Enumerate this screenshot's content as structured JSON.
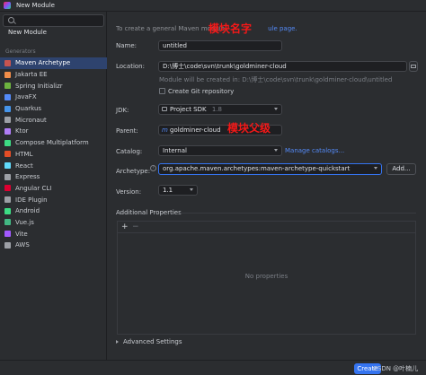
{
  "window": {
    "title": "New Module",
    "app_icon": "intellij-idea-icon"
  },
  "sidebar": {
    "search_placeholder": "",
    "top_item": "New Module",
    "generators_heading": "Generators",
    "items": [
      {
        "label": "Maven Archetype",
        "icon": "maven-icon",
        "color": "#c75450",
        "selected": true
      },
      {
        "label": "Jakarta EE",
        "icon": "jakarta-icon",
        "color": "#f08d49"
      },
      {
        "label": "Spring Initializr",
        "icon": "spring-icon",
        "color": "#6db33f"
      },
      {
        "label": "JavaFX",
        "icon": "javafx-icon",
        "color": "#548af7"
      },
      {
        "label": "Quarkus",
        "icon": "quarkus-icon",
        "color": "#4695eb"
      },
      {
        "label": "Micronaut",
        "icon": "micronaut-icon",
        "color": "#9da0a6"
      },
      {
        "label": "Ktor",
        "icon": "ktor-icon",
        "color": "#b07df6"
      },
      {
        "label": "Compose Multiplatform",
        "icon": "compose-icon",
        "color": "#3ddc84"
      },
      {
        "label": "HTML",
        "icon": "html-icon",
        "color": "#e44d26"
      },
      {
        "label": "React",
        "icon": "react-icon",
        "color": "#61dafb"
      },
      {
        "label": "Express",
        "icon": "express-icon",
        "color": "#9da0a6"
      },
      {
        "label": "Angular CLI",
        "icon": "angular-icon",
        "color": "#dd0031"
      },
      {
        "label": "IDE Plugin",
        "icon": "plugin-icon",
        "color": "#9da0a6"
      },
      {
        "label": "Android",
        "icon": "android-icon",
        "color": "#3ddc84"
      },
      {
        "label": "Vue.js",
        "icon": "vue-icon",
        "color": "#42b883"
      },
      {
        "label": "Vite",
        "icon": "vite-icon",
        "color": "#a259ff"
      },
      {
        "label": "AWS",
        "icon": "aws-icon",
        "color": "#9da0a6"
      }
    ]
  },
  "form": {
    "intro_prefix": "To create a general Maven module",
    "intro_link": "ule page.",
    "name_label": "Name:",
    "name_value": "untitled",
    "location_label": "Location:",
    "location_value": "D:\\博士\\code\\svn\\trunk\\goldminer-cloud",
    "location_hint": "Module will be created in: D:\\博士\\code\\svn\\trunk\\goldminer-cloud\\untitled",
    "git_label": "Create Git repository",
    "jdk_label": "JDK:",
    "jdk_value": "Project SDK",
    "jdk_version": "1.8",
    "parent_label": "Parent:",
    "parent_value": "goldminer-cloud",
    "catalog_label": "Catalog:",
    "catalog_value": "Internal",
    "manage_catalogs": "Manage catalogs...",
    "archetype_label": "Archetype:",
    "archetype_value": "org.apache.maven.archetypes:maven-archetype-quickstart",
    "add_button": "Add...",
    "version_label": "Version:",
    "version_value": "1.1",
    "additional_props_title": "Additional Properties",
    "add_prop": "+",
    "remove_prop": "−",
    "no_properties": "No properties",
    "advanced_settings": "Advanced Settings"
  },
  "annotations": {
    "module_name": "模块名字",
    "module_parent": "模块父级",
    "color": "#f51818"
  },
  "footer": {
    "create_button": "Create",
    "watermark": "CSDN @叶楠儿"
  },
  "colors": {
    "accent": "#3574f0",
    "selection": "#2e436e",
    "link": "#548af7"
  }
}
